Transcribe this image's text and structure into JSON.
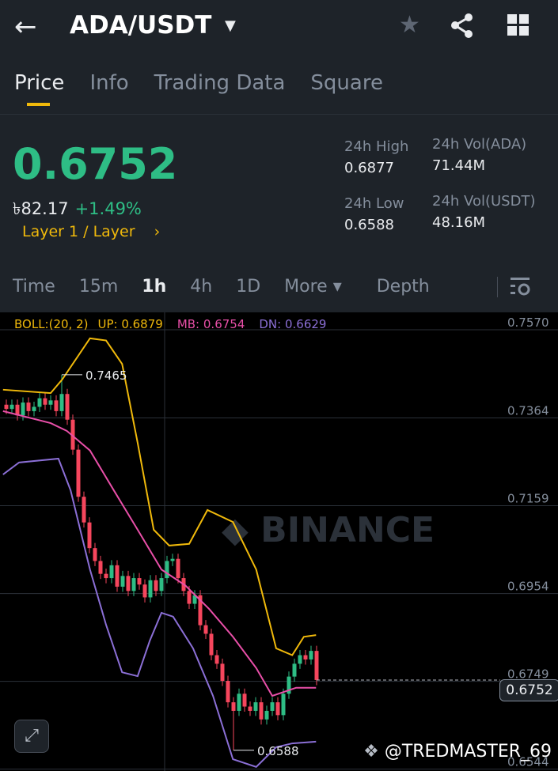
{
  "header": {
    "back_icon": "arrow-left",
    "pair": "ADA/USDT",
    "star_icon": "star",
    "share_icon": "share",
    "grid_icon": "grid"
  },
  "tabs": [
    {
      "label": "Price"
    },
    {
      "label": "Info"
    },
    {
      "label": "Trading Data"
    },
    {
      "label": "Square"
    }
  ],
  "ticker": {
    "price": "0.6752",
    "fiat": "৳82.17",
    "change": "+1.49%",
    "category": "Layer 1 / Layer",
    "high_label": "24h High",
    "high": "0.6877",
    "low_label": "24h Low",
    "low": "0.6588",
    "vol_base_label": "24h Vol(ADA)",
    "vol_base": "71.44M",
    "vol_quote_label": "24h Vol(USDT)",
    "vol_quote": "48.16M"
  },
  "intervals": [
    {
      "label": "Time"
    },
    {
      "label": "15m"
    },
    {
      "label": "1h"
    },
    {
      "label": "4h"
    },
    {
      "label": "1D"
    },
    {
      "label": "More ▾"
    },
    {
      "label": "Depth"
    }
  ],
  "boll": {
    "name": "BOLL:(20, 2)",
    "up": "UP: 0.6879",
    "mb": "MB: 0.6754",
    "dn": "DN: 0.6629"
  },
  "colors": {
    "up": "#2ebd85",
    "down": "#f6465d",
    "upper": "#f0b90b",
    "mid": "#e84fa8",
    "lower": "#8b6fd6"
  },
  "chart_data": {
    "type": "candlestick",
    "y_ticks": [
      "0.7570",
      "0.7364",
      "0.7159",
      "0.6954",
      "0.6749",
      "0.6544"
    ],
    "y_tick_values": [
      0.757,
      0.7364,
      0.7159,
      0.6954,
      0.6749,
      0.6544
    ],
    "closes": [
      0.7385,
      0.7395,
      0.737,
      0.74,
      0.738,
      0.739,
      0.741,
      0.7395,
      0.7405,
      0.738,
      0.742,
      0.736,
      0.729,
      0.718,
      0.712,
      0.706,
      0.703,
      0.7,
      0.699,
      0.702,
      0.697,
      0.6995,
      0.696,
      0.699,
      0.6975,
      0.6945,
      0.6985,
      0.696,
      0.699,
      0.703,
      0.7035,
      0.699,
      0.696,
      0.693,
      0.695,
      0.688,
      0.686,
      0.681,
      0.679,
      0.675,
      0.67,
      0.668,
      0.672,
      0.669,
      0.668,
      0.67,
      0.666,
      0.668,
      0.67,
      0.667,
      0.672,
      0.676,
      0.679,
      0.681,
      0.68,
      0.682,
      0.6752
    ],
    "max_label": "0.7465",
    "max_index": 10,
    "max_value": 0.7465,
    "min_label": "0.6588",
    "min_index": 41,
    "min_value": 0.6588,
    "last_price": "0.6752",
    "last_value": 0.6752,
    "upper": [
      [
        -0.6,
        0.743
      ],
      [
        8,
        0.7422
      ],
      [
        10.1,
        0.7454
      ],
      [
        15.1,
        0.755
      ],
      [
        18,
        0.7545
      ],
      [
        20.9,
        0.749
      ],
      [
        23.7,
        0.7306
      ],
      [
        26.6,
        0.7103
      ],
      [
        29.4,
        0.7066
      ],
      [
        33,
        0.707
      ],
      [
        36.3,
        0.7149
      ],
      [
        40.9,
        0.7121
      ],
      [
        45.1,
        0.701
      ],
      [
        48.7,
        0.6826
      ],
      [
        51.6,
        0.681
      ],
      [
        53.7,
        0.6853
      ],
      [
        55.9,
        0.6857
      ]
    ],
    "mid": [
      [
        -0.6,
        0.738
      ],
      [
        8,
        0.7352
      ],
      [
        10.9,
        0.7334
      ],
      [
        15.1,
        0.7288
      ],
      [
        19.4,
        0.7195
      ],
      [
        23.7,
        0.7103
      ],
      [
        28,
        0.701
      ],
      [
        32.3,
        0.6973
      ],
      [
        36.6,
        0.6918
      ],
      [
        40.9,
        0.6853
      ],
      [
        45.1,
        0.678
      ],
      [
        48,
        0.6715
      ],
      [
        52.3,
        0.6734
      ],
      [
        55.9,
        0.6734
      ]
    ],
    "lower": [
      [
        -0.6,
        0.7232
      ],
      [
        2.3,
        0.726
      ],
      [
        9.4,
        0.7269
      ],
      [
        11.6,
        0.7195
      ],
      [
        15.1,
        0.701
      ],
      [
        18,
        0.6881
      ],
      [
        20.9,
        0.677
      ],
      [
        23.7,
        0.6761
      ],
      [
        25.9,
        0.6844
      ],
      [
        28,
        0.6909
      ],
      [
        30.1,
        0.69
      ],
      [
        33.7,
        0.6826
      ],
      [
        37.3,
        0.6715
      ],
      [
        40.9,
        0.6567
      ],
      [
        45.1,
        0.6549
      ],
      [
        48.7,
        0.6595
      ],
      [
        51.6,
        0.6604
      ],
      [
        55.9,
        0.6608
      ]
    ],
    "watermark": "BINANCE"
  },
  "footer": {
    "expand_icon": "expand",
    "credit": "@TREDMASTER_69"
  }
}
